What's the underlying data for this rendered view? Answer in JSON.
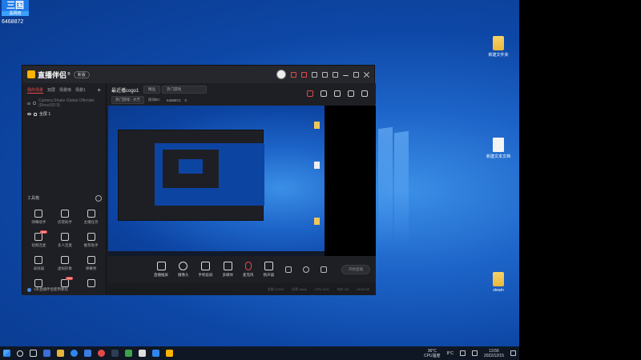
{
  "watermark": {
    "logo": "三国",
    "sub": "黑网络",
    "id": "6468872"
  },
  "desktop_icons": [
    {
      "label": "新建文件夹",
      "kind": "folder"
    },
    {
      "label": "新建文本文档",
      "kind": "doc"
    },
    {
      "label": "steam",
      "kind": "folder"
    }
  ],
  "app": {
    "brand": "直播伴侣",
    "brand_sup": "®",
    "brand_pill": "新版",
    "left_tabs": [
      "我的场景",
      "双屏",
      "场景库",
      "场景1"
    ],
    "add_label": "+",
    "sources": [
      {
        "label": "Camera Shake Global Offender (Direct3D 9)",
        "on": false
      },
      {
        "label": "全屏 1",
        "on": true
      }
    ],
    "tools_title": "工具箱",
    "tools": [
      {
        "label": "弹幕助手",
        "badge": ""
      },
      {
        "label": "房管助手",
        "badge": ""
      },
      {
        "label": "主播任务",
        "badge": ""
      },
      {
        "label": "视频连麦",
        "badge": "NEW"
      },
      {
        "label": "多人连麦",
        "badge": ""
      },
      {
        "label": "推荐助手",
        "badge": ""
      },
      {
        "label": "录屏器",
        "badge": ""
      },
      {
        "label": "虚拟形象",
        "badge": ""
      },
      {
        "label": "弹幕秀",
        "badge": ""
      },
      {
        "label": "",
        "badge": ""
      },
      {
        "label": "",
        "badge": "NEW"
      },
      {
        "label": "",
        "badge": ""
      }
    ],
    "tip": "1条直播伴侣使用教程",
    "info": {
      "title": "最近播cogo1",
      "chip1": "精品",
      "chip2": "热门游戏",
      "row2_chip": "热门游戏 - 大厅",
      "room_label": "房间ID：",
      "room_id": "6468872",
      "likes": "0"
    },
    "controls": [
      {
        "label": "直播推屏"
      },
      {
        "label": "摄像头"
      },
      {
        "label": "手机投屏"
      },
      {
        "label": "多媒体"
      },
      {
        "label": "麦克风"
      },
      {
        "label": "扬声器"
      }
    ],
    "go_live": "开始直播",
    "status": [
      "丢帧 0.00%",
      "码率 0kb/s",
      "CPU 21%",
      "内存 4%",
      "00:00:00"
    ]
  },
  "taskbar": {
    "weather": "36°C",
    "weather_sub": "CPU温度",
    "temp2": "8°C",
    "time": "13:56",
    "date": "2022/12/15"
  },
  "colors": {
    "accent": "#e24a4a",
    "brand": "#ffb300",
    "desktop": "#1d64c8"
  }
}
